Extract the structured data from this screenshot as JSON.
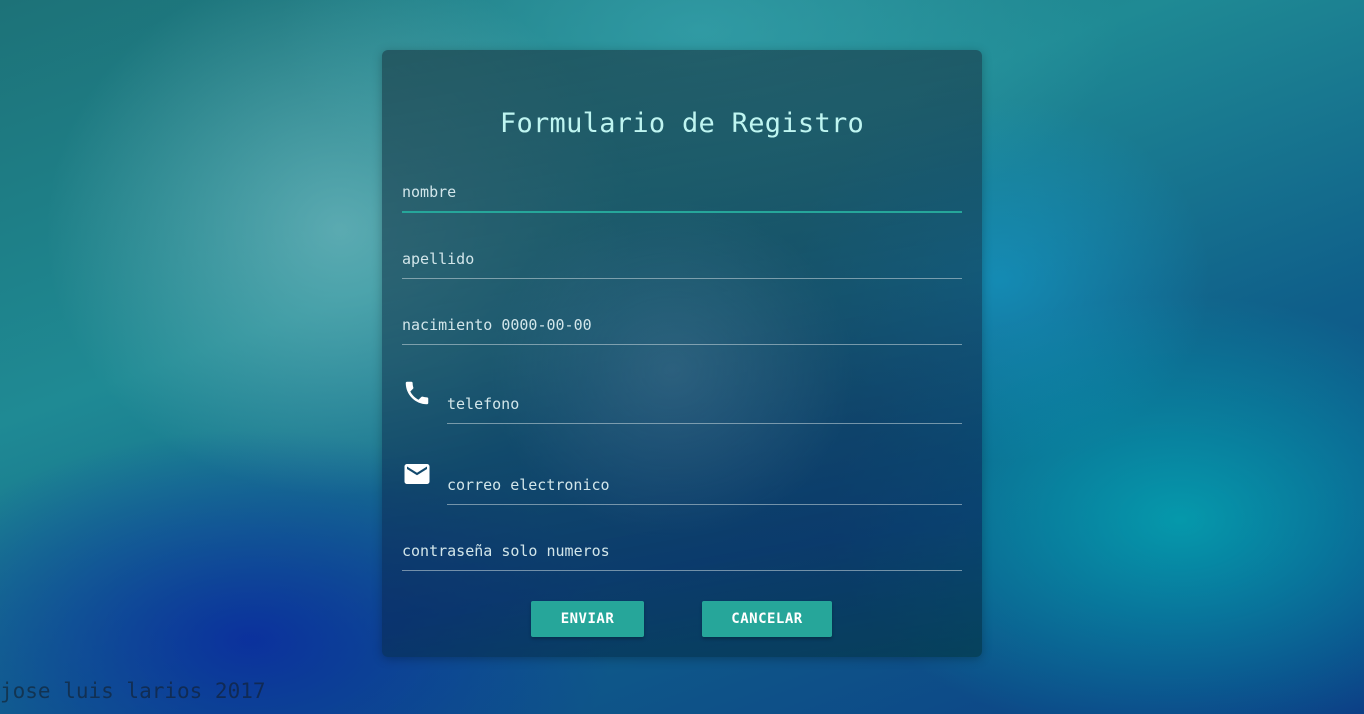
{
  "form": {
    "title": "Formulario de Registro",
    "fields": [
      {
        "placeholder": "nombre",
        "value": ""
      },
      {
        "placeholder": "apellido",
        "value": ""
      },
      {
        "placeholder": "nacimiento 0000-00-00",
        "value": ""
      },
      {
        "placeholder": "telefono",
        "value": "",
        "icon": "phone-icon"
      },
      {
        "placeholder": "correo electronico",
        "value": "",
        "icon": "email-icon"
      },
      {
        "placeholder": "contraseña solo numeros",
        "value": ""
      }
    ],
    "submit_label": "ENVIAR",
    "cancel_label": "CANCELAR"
  },
  "footer": {
    "credit": "jose luis larios 2017"
  },
  "colors": {
    "accent": "#26a69a",
    "title": "#bff5f1"
  }
}
